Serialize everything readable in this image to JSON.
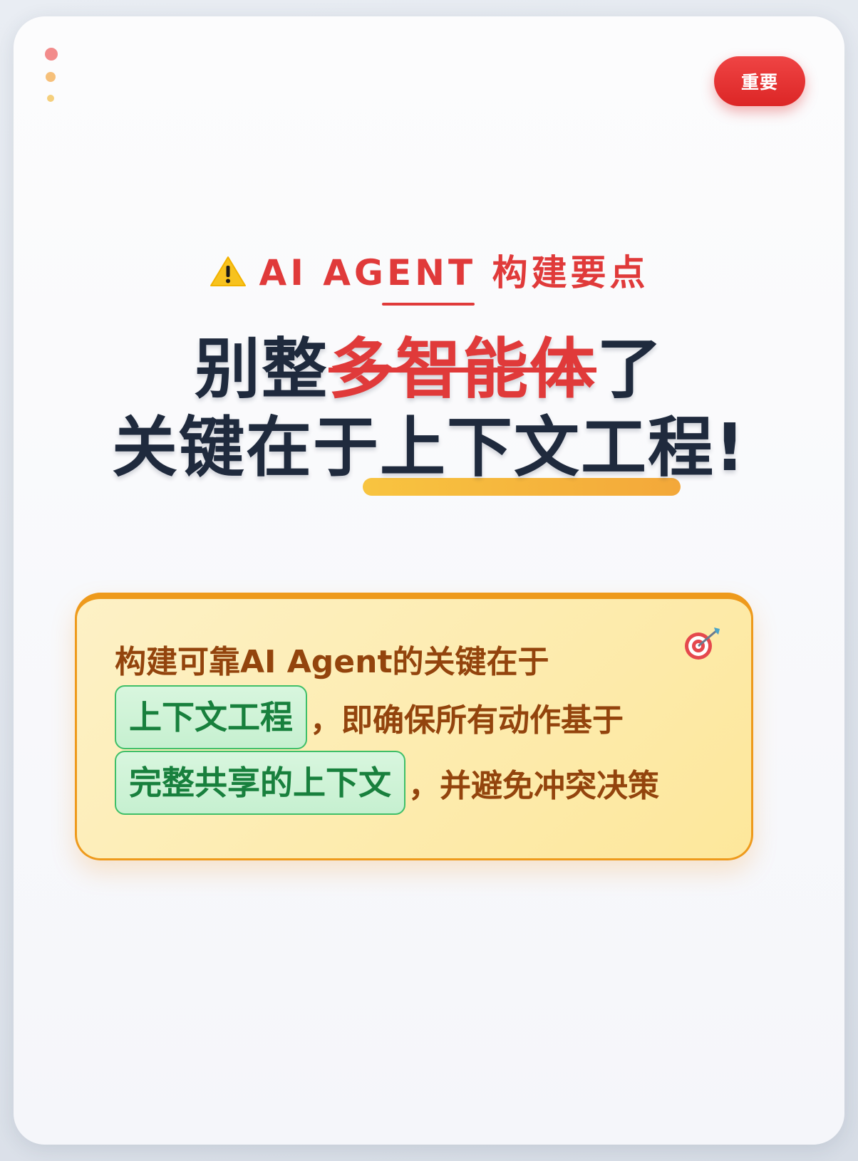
{
  "badge": {
    "label": "重要"
  },
  "kicker": {
    "icon": "warning-icon",
    "text": "AI AGENT 构建要点"
  },
  "headline": {
    "line1_before": "别整",
    "line1_strike": "多智能体",
    "line1_after": "了",
    "line2_before": "关键在于",
    "line2_highlight": "上下文工程",
    "line2_after": "!"
  },
  "note": {
    "icon": "target-icon",
    "line1": "构建可靠AI Agent的关键在于",
    "chip1": "上下文工程",
    "line2_rest": "，即确保所有动作基于",
    "chip2": "完整共享的上下文",
    "line3_rest": "，并避免冲突决策"
  },
  "colors": {
    "accent_red": "#e03a3a",
    "headline": "#1f2a3d",
    "note_text": "#93440d",
    "chip_green": "#18803d",
    "highlight_bar": "#f8c440"
  }
}
